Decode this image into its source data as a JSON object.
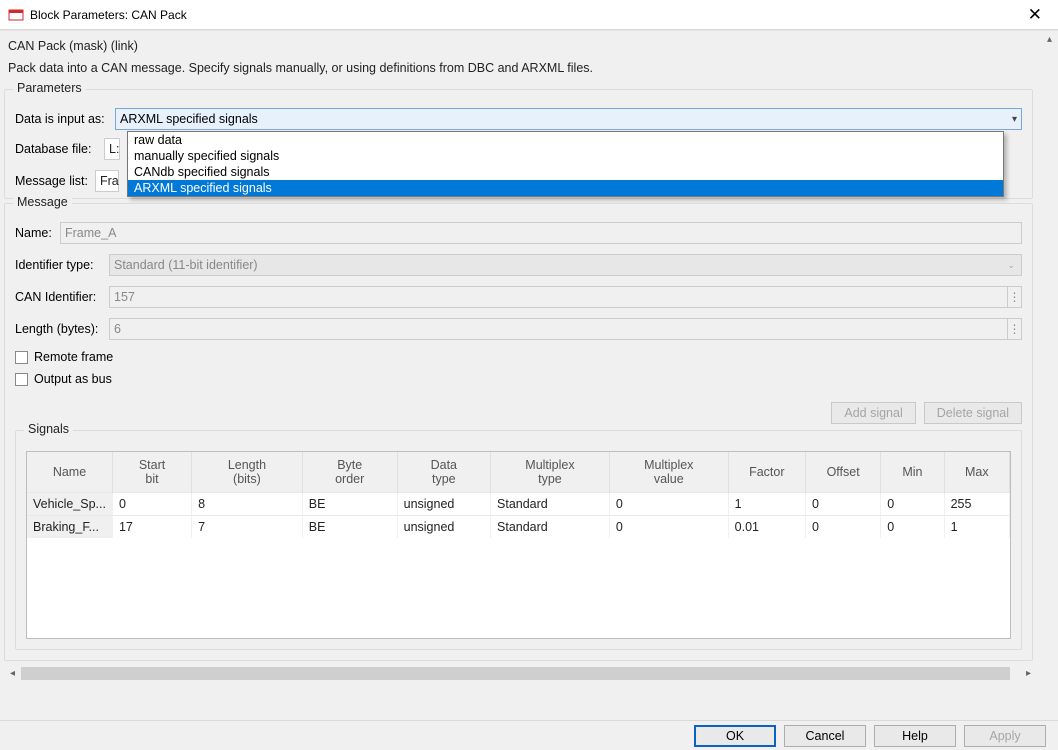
{
  "window": {
    "title": "Block Parameters: CAN Pack"
  },
  "header": {
    "mask_line": "CAN Pack (mask) (link)",
    "description": "Pack data into a CAN message. Specify signals manually, or using definitions from DBC and ARXML files."
  },
  "parameters": {
    "group_label": "Parameters",
    "data_input_label": "Data is input as:",
    "data_input_selected": "ARXML specified signals",
    "data_input_options": [
      "raw data",
      "manually specified signals",
      "CANdb specified signals",
      "ARXML specified signals"
    ],
    "database_file_label": "Database file:",
    "database_file_prefix": "L:",
    "message_list_label": "Message list:",
    "message_list_prefix": "Fra"
  },
  "message": {
    "group_label": "Message",
    "name_label": "Name:",
    "name_value": "Frame_A",
    "id_type_label": "Identifier type:",
    "id_type_value": "Standard (11-bit identifier)",
    "can_id_label": "CAN Identifier:",
    "can_id_value": "157",
    "length_label": "Length (bytes):",
    "length_value": "6",
    "remote_frame_label": "Remote frame",
    "output_as_bus_label": "Output as bus"
  },
  "signals": {
    "group_label": "Signals",
    "add_button": "Add signal",
    "delete_button": "Delete signal",
    "columns": {
      "name": "Name",
      "start_bit_l1": "Start",
      "start_bit_l2": "bit",
      "length_l1": "Length",
      "length_l2": "(bits)",
      "byte_l1": "Byte",
      "byte_l2": "order",
      "data_l1": "Data",
      "data_l2": "type",
      "mux_l1": "Multiplex",
      "mux_l2": "type",
      "muxv_l1": "Multiplex",
      "muxv_l2": "value",
      "factor": "Factor",
      "offset": "Offset",
      "min": "Min",
      "max": "Max"
    },
    "rows": [
      {
        "name": "Vehicle_Sp...",
        "start": "0",
        "len": "8",
        "order": "BE",
        "dtype": "unsigned",
        "mux": "Standard",
        "muxv": "0",
        "factor": "1",
        "offset": "0",
        "min": "0",
        "max": "255"
      },
      {
        "name": "Braking_F...",
        "start": "17",
        "len": "7",
        "order": "BE",
        "dtype": "unsigned",
        "mux": "Standard",
        "muxv": "0",
        "factor": "0.01",
        "offset": "0",
        "min": "0",
        "max": "1"
      }
    ]
  },
  "buttons": {
    "ok": "OK",
    "cancel": "Cancel",
    "help": "Help",
    "apply": "Apply"
  }
}
